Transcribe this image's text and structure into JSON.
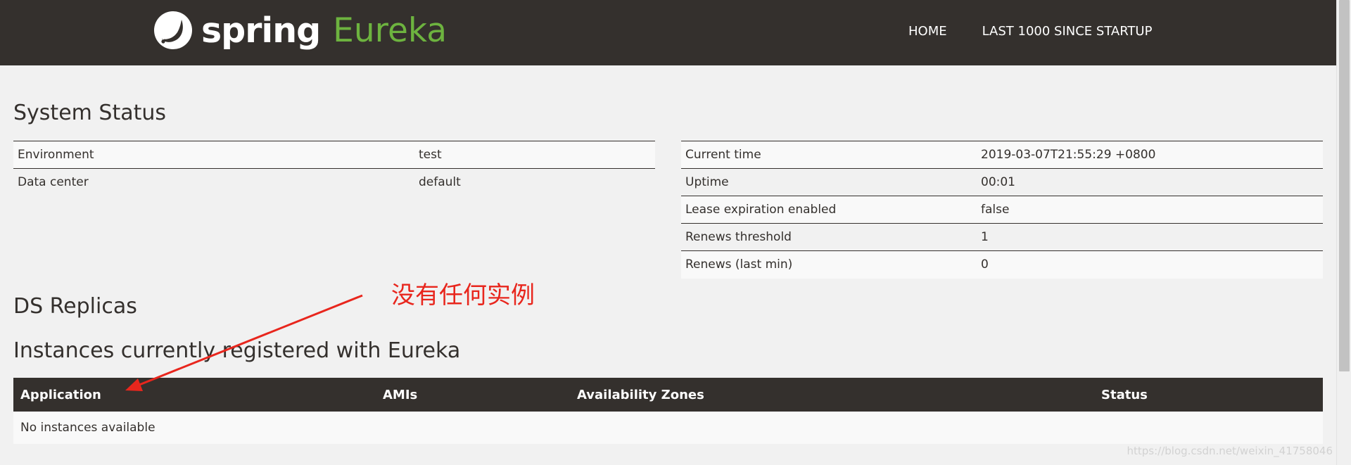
{
  "brand": {
    "spring": "spring",
    "eureka": "Eureka"
  },
  "nav": {
    "home": "HOME",
    "last1000": "LAST 1000 SINCE STARTUP"
  },
  "system_status": {
    "title": "System Status",
    "left": [
      {
        "key": "Environment",
        "value": "test"
      },
      {
        "key": "Data center",
        "value": "default"
      }
    ],
    "right": [
      {
        "key": "Current time",
        "value": "2019-03-07T21:55:29 +0800"
      },
      {
        "key": "Uptime",
        "value": "00:01"
      },
      {
        "key": "Lease expiration enabled",
        "value": "false"
      },
      {
        "key": "Renews threshold",
        "value": "1"
      },
      {
        "key": "Renews (last min)",
        "value": "0"
      }
    ]
  },
  "ds_replicas": {
    "title": "DS Replicas"
  },
  "instances": {
    "title": "Instances currently registered with Eureka",
    "columns": [
      "Application",
      "AMIs",
      "Availability Zones",
      "Status"
    ],
    "empty_message": "No instances available"
  },
  "annotation": {
    "text": "没有任何实例",
    "color": "#e8261d"
  },
  "watermark": "https://blog.csdn.net/weixin_41758046",
  "colors": {
    "navbar": "#34302d",
    "accent": "#6db33f",
    "background": "#f1f1f1"
  }
}
